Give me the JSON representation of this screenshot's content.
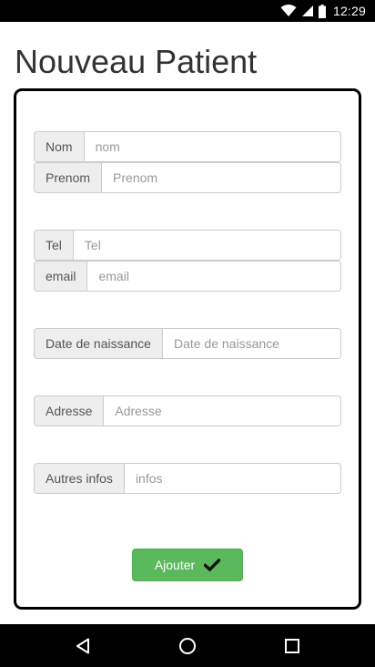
{
  "status_bar": {
    "time": "12:29",
    "icons": [
      "wifi-icon",
      "signal-icon",
      "battery-icon"
    ]
  },
  "page": {
    "title": "Nouveau Patient"
  },
  "form": {
    "fields": [
      {
        "label": "Nom",
        "placeholder": "nom",
        "value": ""
      },
      {
        "label": "Prenom",
        "placeholder": "Prenom",
        "value": ""
      },
      {
        "label": "Tel",
        "placeholder": "Tel",
        "value": ""
      },
      {
        "label": "email",
        "placeholder": "email",
        "value": ""
      },
      {
        "label": "Date de naissance",
        "placeholder": "Date de naissance",
        "value": ""
      },
      {
        "label": "Adresse",
        "placeholder": "Adresse",
        "value": ""
      },
      {
        "label": "Autres infos",
        "placeholder": "infos",
        "value": ""
      }
    ],
    "submit_label": "Ajouter",
    "submit_icon": "checkmark-icon",
    "accent_color": "#5cb85c"
  },
  "nav_bar": {
    "icons": [
      "back-icon",
      "home-icon",
      "recents-icon"
    ]
  }
}
